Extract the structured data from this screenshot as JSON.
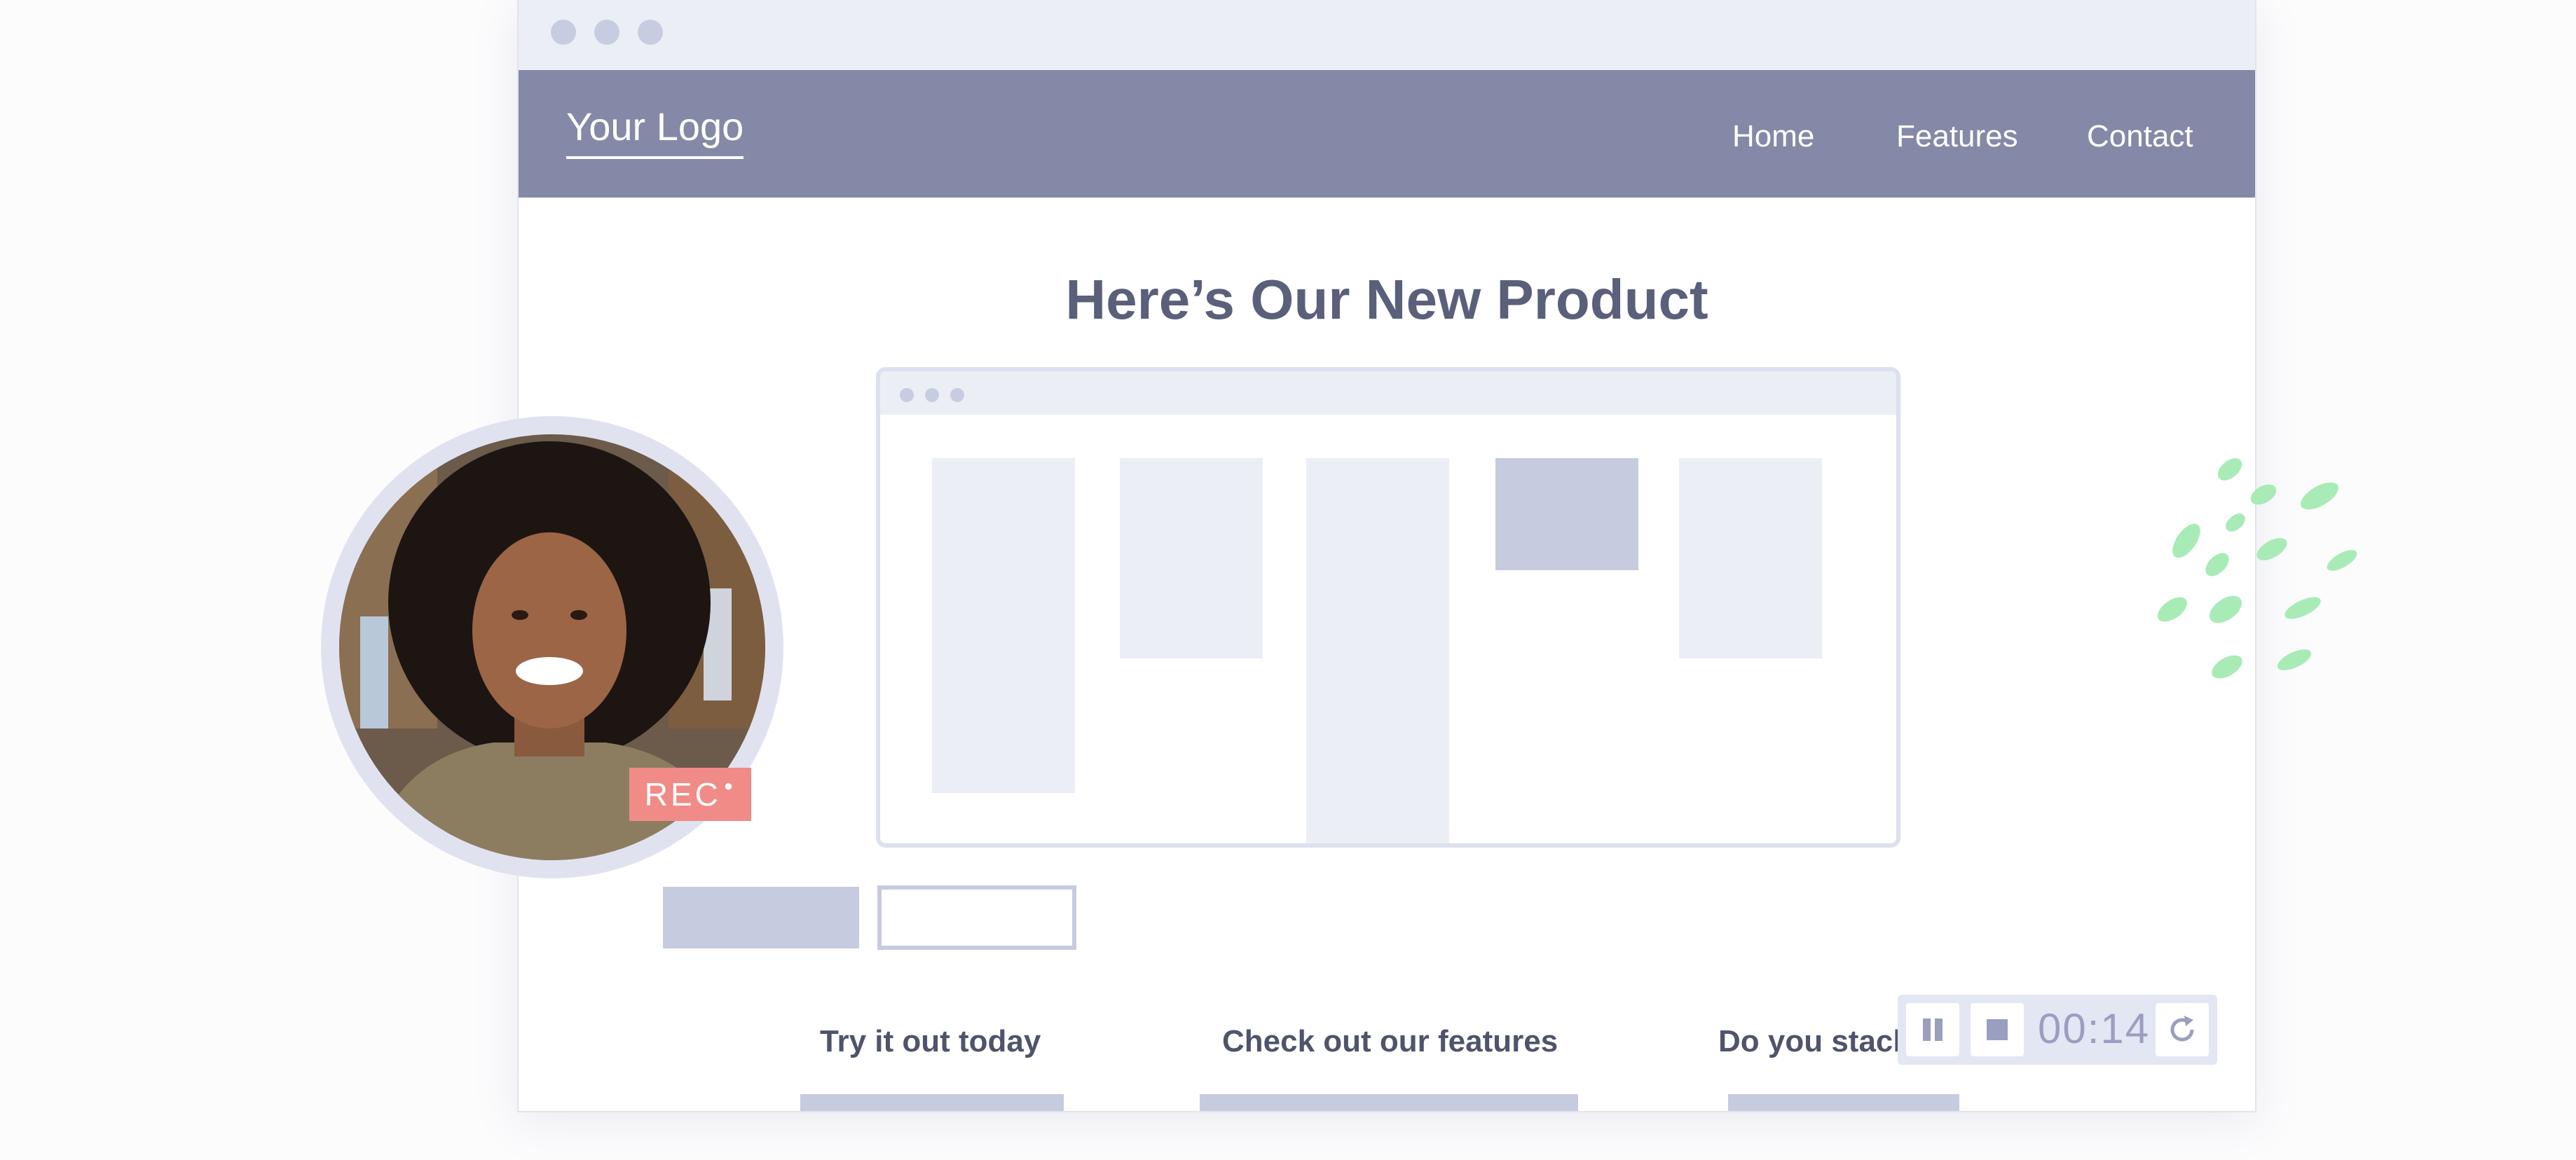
{
  "nav": {
    "logo": "Your Logo",
    "links": [
      "Home",
      "Features",
      "Contact"
    ]
  },
  "hero": {
    "title": "Here’s Our New Product"
  },
  "features": [
    {
      "title": "Try it out today"
    },
    {
      "title": "Check out our features"
    },
    {
      "title": "Do you stack"
    }
  ],
  "recording": {
    "badge": "REC",
    "timer": "00:14",
    "controls": [
      "pause-icon",
      "stop-icon",
      "restart-icon"
    ]
  },
  "colors": {
    "nav_bg": "#8389a6",
    "rec_badge": "#f08b88",
    "accent_green": "#9de6ab",
    "placeholder": "#c7cbdf"
  }
}
